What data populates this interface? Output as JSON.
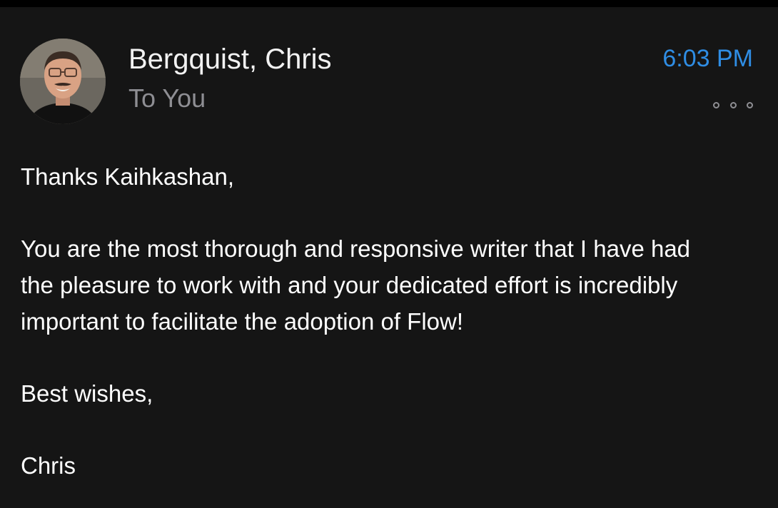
{
  "header": {
    "sender_name": "Bergquist, Chris",
    "recipient": "To You",
    "time": "6:03 PM",
    "accent_color": "#2f8de4"
  },
  "icons": {
    "avatar": "sender-photo",
    "more": "more-options-icon"
  },
  "body": {
    "greeting": "Thanks Kaihkashan,",
    "paragraph": "You are the most thorough and responsive writer that I have had\nthe pleasure to work with and your dedicated effort is incredibly\nimportant to facilitate the adoption of Flow!",
    "closing": "Best wishes,",
    "signature": "Chris"
  }
}
